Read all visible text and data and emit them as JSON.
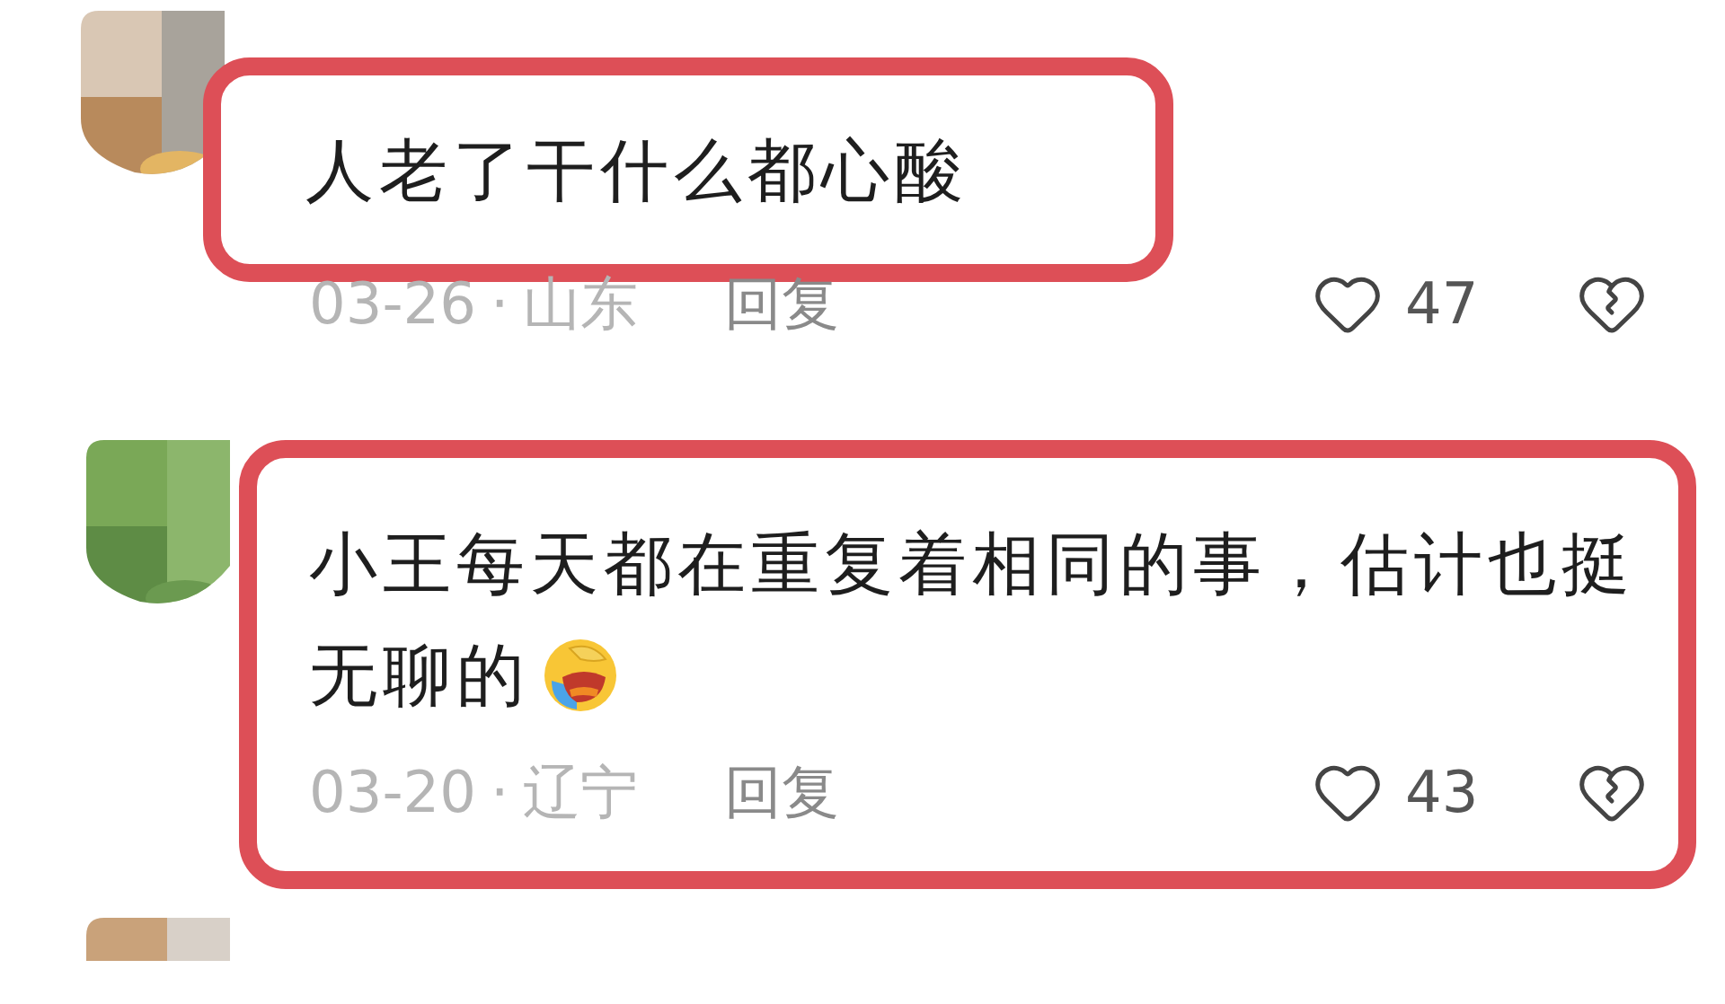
{
  "comments": [
    {
      "kind": "text-highlight",
      "avatar": {
        "kind": "picture"
      },
      "text_lines": [
        "人老了干什么都心酸"
      ],
      "emoji": false,
      "date": "03-26",
      "separator": "·",
      "region": "山东",
      "reply": "回复",
      "likes": "47"
    },
    {
      "kind": "full-highlight",
      "avatar": {
        "kind": "picture"
      },
      "text_lines": [
        "小王每天都在重复着相同的事，估计也挺",
        "无聊的"
      ],
      "emoji": true,
      "date": "03-20",
      "separator": "·",
      "region": "辽宁",
      "reply": "回复",
      "likes": "43"
    },
    {
      "kind": "avatar-only",
      "avatar": {
        "kind": "picture"
      }
    }
  ]
}
